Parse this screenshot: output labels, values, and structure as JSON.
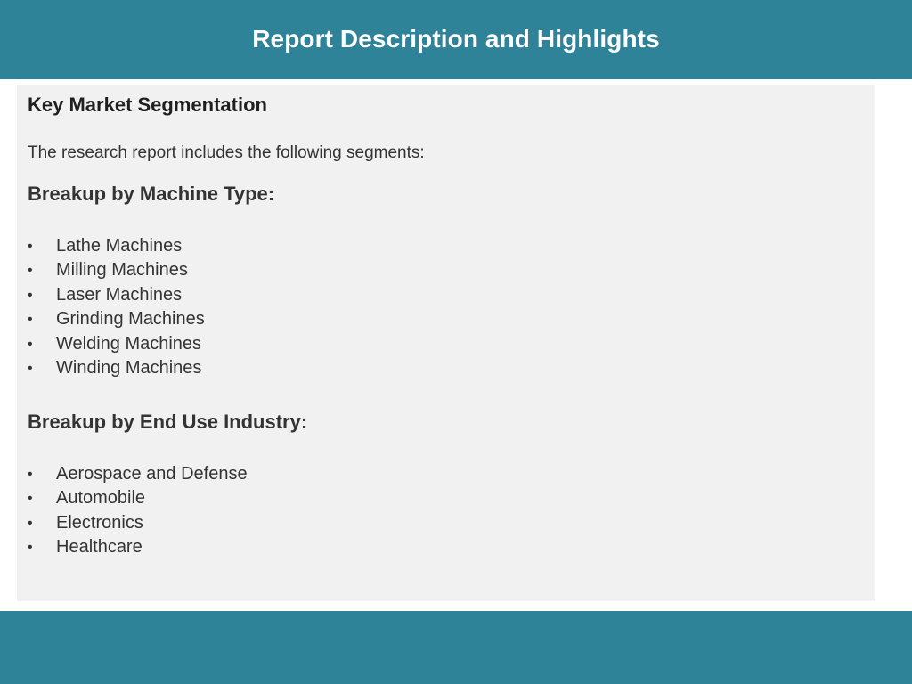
{
  "header": {
    "title": "Report Description and Highlights"
  },
  "content": {
    "section_title": "Key Market Segmentation",
    "intro": "The research report includes the following segments:",
    "groups": [
      {
        "title": "Breakup by Machine Type:",
        "items": [
          "Lathe Machines",
          "Milling Machines",
          "Laser Machines",
          "Grinding Machines",
          "Welding Machines",
          "Winding Machines"
        ]
      },
      {
        "title": "Breakup by End Use Industry:",
        "items": [
          "Aerospace and Defense",
          "Automobile",
          "Electronics",
          "Healthcare"
        ]
      }
    ],
    "bullet_symbol": "•"
  },
  "colors": {
    "banner": "#2f8399",
    "panel": "#f1f1f1",
    "text": "#333333"
  }
}
